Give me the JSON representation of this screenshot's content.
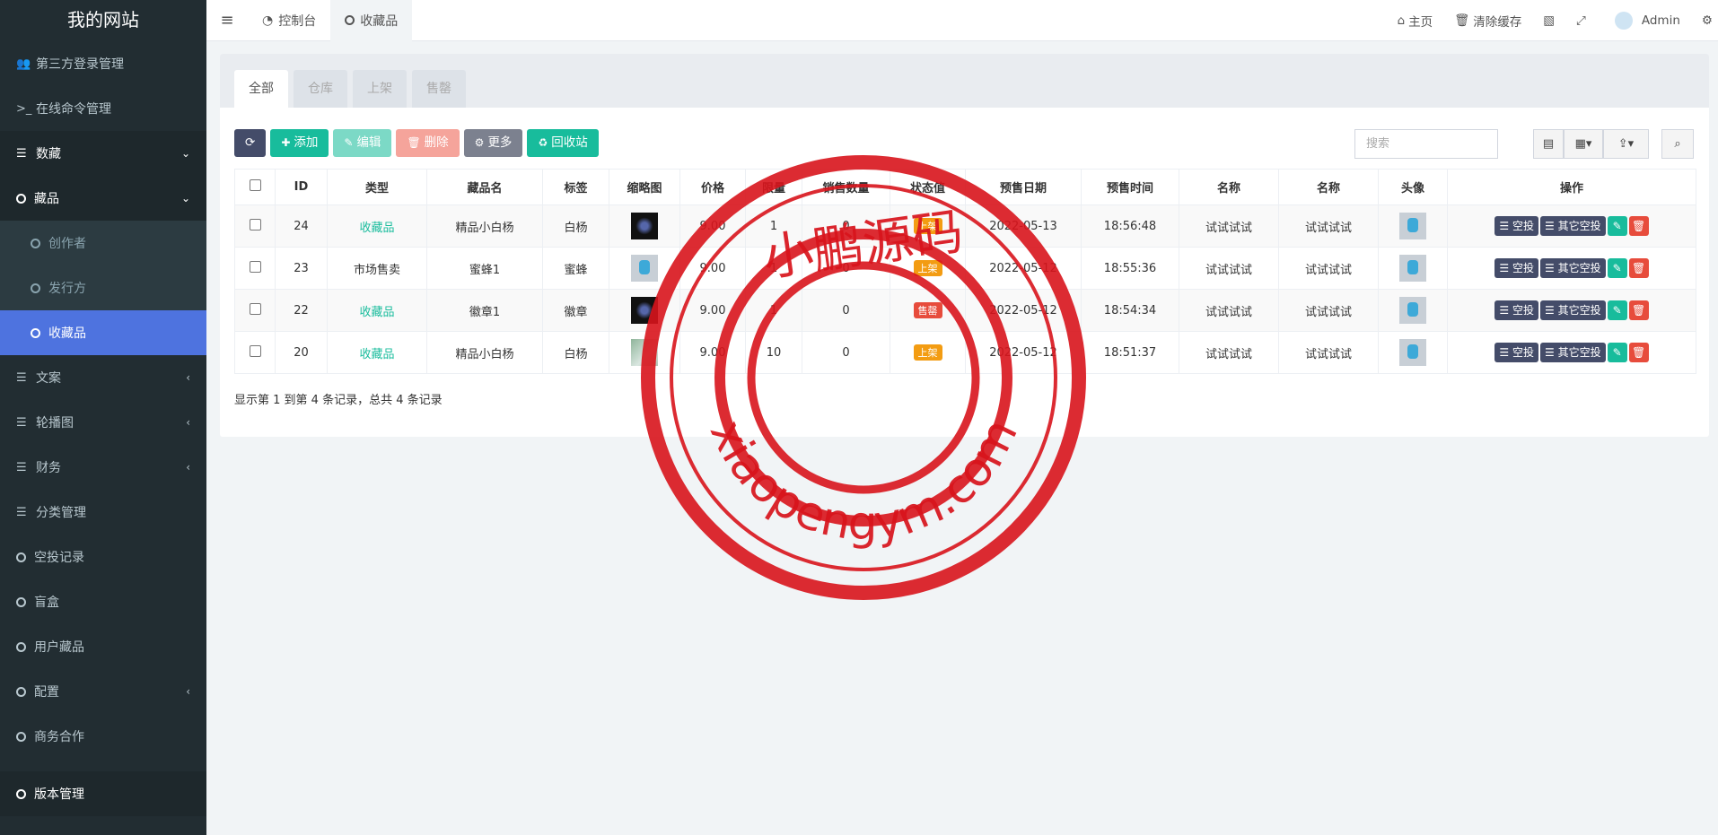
{
  "site": {
    "title": "我的网站"
  },
  "sidebar": {
    "items": [
      {
        "label": "第三方登录管理",
        "icon": "users-icon",
        "type": "top"
      },
      {
        "label": "在线命令管理",
        "icon": "terminal-icon",
        "type": "top"
      },
      {
        "label": "数藏",
        "icon": "list-icon",
        "type": "open",
        "arrow": "⌄"
      },
      {
        "label": "藏品",
        "icon": "circle-icon",
        "type": "open",
        "arrow": "⌄"
      },
      {
        "label": "创作者",
        "icon": "circle-icon",
        "type": "sub"
      },
      {
        "label": "发行方",
        "icon": "circle-icon",
        "type": "sub"
      },
      {
        "label": "收藏品",
        "icon": "circle-icon",
        "type": "active"
      },
      {
        "label": "文案",
        "icon": "list-icon",
        "type": "top",
        "arrow": "‹"
      },
      {
        "label": "轮播图",
        "icon": "list-icon",
        "type": "top",
        "arrow": "‹"
      },
      {
        "label": "财务",
        "icon": "list-icon",
        "type": "top",
        "arrow": "‹"
      },
      {
        "label": "分类管理",
        "icon": "list-icon",
        "type": "top"
      },
      {
        "label": "空投记录",
        "icon": "circle-icon",
        "type": "top"
      },
      {
        "label": "盲盒",
        "icon": "circle-icon",
        "type": "top"
      },
      {
        "label": "用户藏品",
        "icon": "circle-icon",
        "type": "top"
      },
      {
        "label": "配置",
        "icon": "circle-icon",
        "type": "top",
        "arrow": "‹"
      },
      {
        "label": "商务合作",
        "icon": "circle-icon",
        "type": "top"
      },
      {
        "label": "版本管理",
        "icon": "circle-icon",
        "type": "bottom"
      }
    ]
  },
  "topbar": {
    "tabs": [
      {
        "label": "控制台"
      },
      {
        "label": "收藏品"
      }
    ],
    "right": {
      "home": "主页",
      "clear_cache": "清除缓存",
      "user": "Admin"
    }
  },
  "panel": {
    "tabs": [
      "全部",
      "仓库",
      "上架",
      "售罄"
    ],
    "toolbar": {
      "add": "添加",
      "edit": "编辑",
      "delete": "删除",
      "more": "更多",
      "recycle": "回收站"
    },
    "search_placeholder": "搜索",
    "columns": [
      "ID",
      "类型",
      "藏品名",
      "标签",
      "缩略图",
      "价格",
      "限量",
      "销售数量",
      "状态值",
      "预售日期",
      "预售时间",
      "名称",
      "名称",
      "头像",
      "操作"
    ],
    "rows": [
      {
        "id": "24",
        "type": "收藏品",
        "type_link": true,
        "name": "精品小白杨",
        "tag": "白杨",
        "thumb": "dark",
        "price": "9.00",
        "limit": "1",
        "sold": "0",
        "status": "上架",
        "status_color": "orange",
        "date": "2022-05-13",
        "time": "18:56:48",
        "n1": "试试试试",
        "n2": "试试试试"
      },
      {
        "id": "23",
        "type": "市场售卖",
        "type_link": false,
        "name": "蜜蜂1",
        "tag": "蜜蜂",
        "thumb": "light",
        "price": "9.00",
        "limit": "1",
        "sold": "0",
        "status": "上架",
        "status_color": "orange",
        "date": "2022-05-12",
        "time": "18:55:36",
        "n1": "试试试试",
        "n2": "试试试试"
      },
      {
        "id": "22",
        "type": "收藏品",
        "type_link": true,
        "name": "徽章1",
        "tag": "徽章",
        "thumb": "dark",
        "price": "9.00",
        "limit": "1",
        "sold": "0",
        "status": "售罄",
        "status_color": "red",
        "date": "2022-05-12",
        "time": "18:54:34",
        "n1": "试试试试",
        "n2": "试试试试"
      },
      {
        "id": "20",
        "type": "收藏品",
        "type_link": true,
        "name": "精品小白杨",
        "tag": "白杨",
        "thumb": "photo",
        "price": "9.00",
        "limit": "10",
        "sold": "0",
        "status": "上架",
        "status_color": "orange",
        "date": "2022-05-12",
        "time": "18:51:37",
        "n1": "试试试试",
        "n2": "试试试试"
      }
    ],
    "actions": {
      "airdrop": "空投",
      "other_airdrop": "其它空投"
    },
    "footer": "显示第 1 到第 4 条记录，总共 4 条记录"
  },
  "watermark": {
    "cn": "小鹏源码",
    "url": "xiaopengym.com"
  }
}
